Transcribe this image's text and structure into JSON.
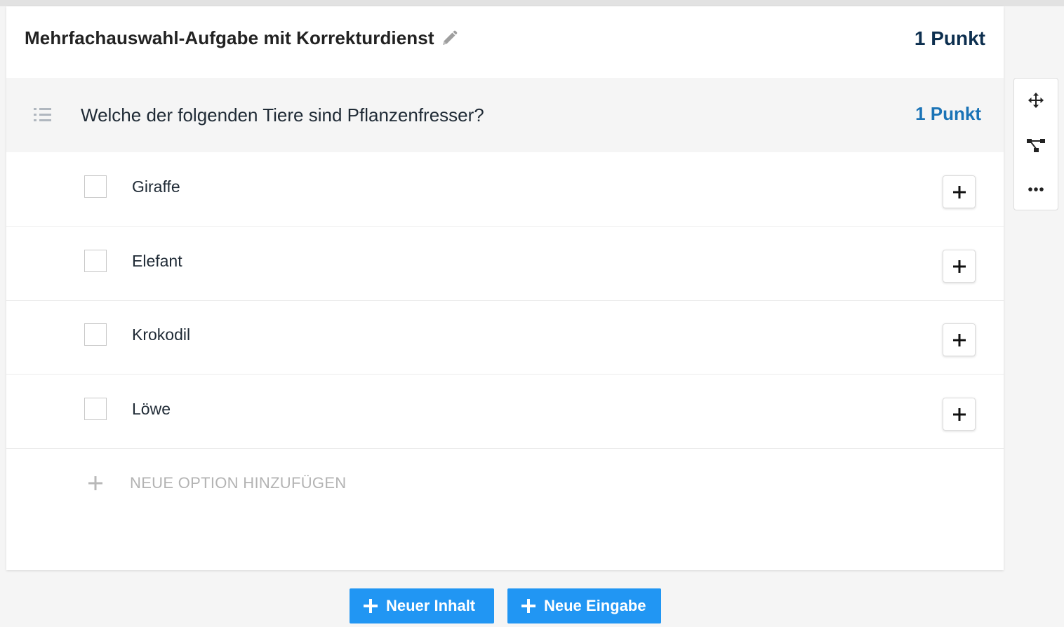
{
  "task": {
    "title": "Mehrfachauswahl-Aufgabe mit Korrekturdienst",
    "points": "1 Punkt"
  },
  "question": {
    "text": "Welche der folgenden Tiere sind Pflanzenfresser?",
    "points": "1 Punkt"
  },
  "options": [
    {
      "label": "Giraffe",
      "checked": false
    },
    {
      "label": "Elefant",
      "checked": false
    },
    {
      "label": "Krokodil",
      "checked": false
    },
    {
      "label": "Löwe",
      "checked": false
    }
  ],
  "add_option_label": "NEUE OPTION HINZUFÜGEN",
  "toolbar": {
    "icons": [
      "move-icon",
      "hierarchy-icon",
      "more-icon"
    ]
  },
  "actions": {
    "new_content": "Neuer Inhalt",
    "new_input": "Neue Eingabe"
  },
  "colors": {
    "accent": "#2196f3",
    "question_points": "#1a73b6",
    "title_points": "#0d2f4f"
  }
}
